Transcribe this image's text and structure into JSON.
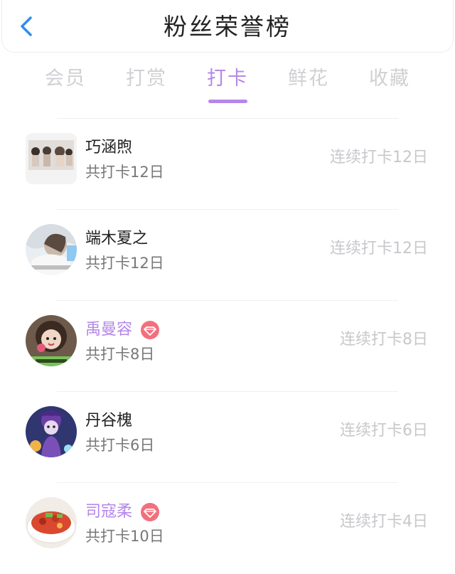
{
  "header": {
    "title": "粉丝荣誉榜"
  },
  "tabs": [
    {
      "label": "会员"
    },
    {
      "label": "打赏"
    },
    {
      "label": "打卡"
    },
    {
      "label": "鲜花"
    },
    {
      "label": "收藏"
    }
  ],
  "active_tab": "打卡",
  "colors": {
    "accent": "#b587e8",
    "vip_badge": "#f2707d",
    "back_icon": "#2f8df0"
  },
  "fans": [
    {
      "name": "巧涵煦",
      "total": "共打卡12日",
      "streak": "连续打卡12日",
      "vip": false
    },
    {
      "name": "端木夏之",
      "total": "共打卡12日",
      "streak": "连续打卡12日",
      "vip": false
    },
    {
      "name": "禹曼容",
      "total": "共打卡8日",
      "streak": "连续打卡8日",
      "vip": true
    },
    {
      "name": "丹谷槐",
      "total": "共打卡6日",
      "streak": "连续打卡6日",
      "vip": false
    },
    {
      "name": "司寇柔",
      "total": "共打卡10日",
      "streak": "连续打卡4日",
      "vip": true
    }
  ]
}
